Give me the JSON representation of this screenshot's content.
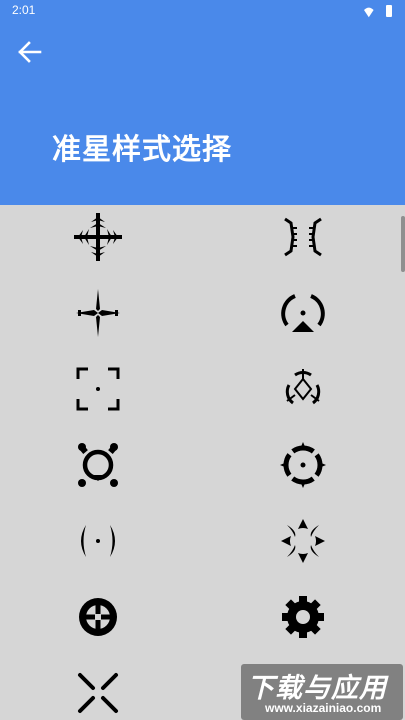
{
  "status_bar": {
    "time": "2:01",
    "icons": [
      "wifi-icon",
      "battery-icon"
    ]
  },
  "header": {
    "back_icon": "arrow-left-icon",
    "title": "准星样式选择",
    "background_color": "#4a89ea"
  },
  "crosshair_styles": [
    {
      "icon": "crosshair-snowflake-icon"
    },
    {
      "icon": "crosshair-brackets-icon"
    },
    {
      "icon": "crosshair-blade-cross-icon"
    },
    {
      "icon": "crosshair-arc-triangle-icon"
    },
    {
      "icon": "crosshair-corner-frame-icon"
    },
    {
      "icon": "crosshair-tri-arc-icon"
    },
    {
      "icon": "crosshair-gear-ring-icon"
    },
    {
      "icon": "crosshair-quad-ring-icon"
    },
    {
      "icon": "crosshair-parentheses-dot-icon"
    },
    {
      "icon": "crosshair-quad-arc-icon"
    },
    {
      "icon": "crosshair-target-ring-icon"
    },
    {
      "icon": "crosshair-cog-icon"
    },
    {
      "icon": "crosshair-x-icon"
    }
  ],
  "watermark": {
    "title": "下载与应用",
    "url": "www.xiazainiao.com"
  }
}
